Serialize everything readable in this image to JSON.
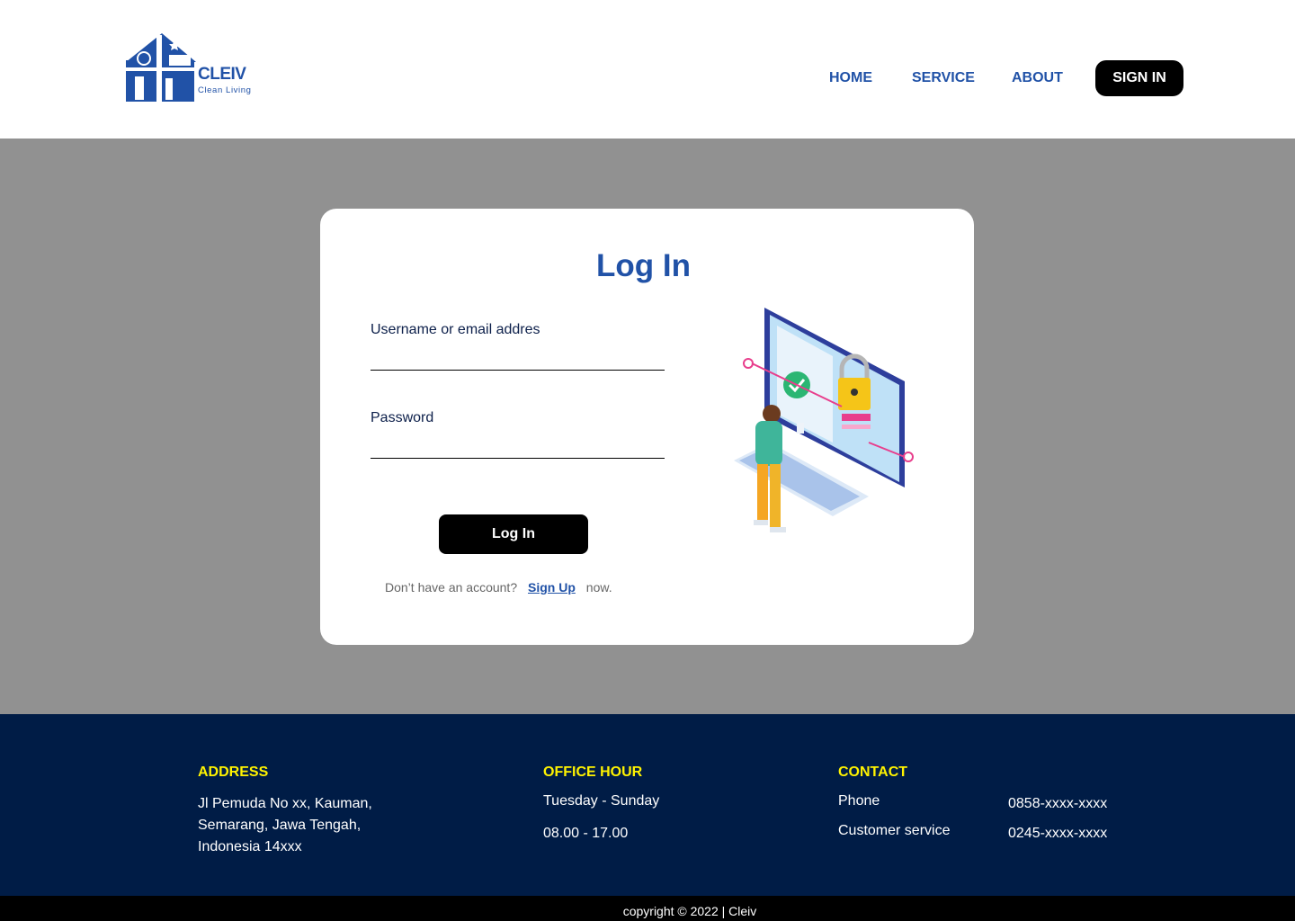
{
  "brand": {
    "name": "CLEIV",
    "tagline": "Clean Living",
    "colors": {
      "primary": "#2152a7",
      "footer_bg": "#001c46",
      "footer_heading": "#fff300"
    }
  },
  "nav": {
    "home": "HOME",
    "service": "SERVICE",
    "about": "ABOUT",
    "signin": "SIGN IN"
  },
  "login": {
    "title": "Log In",
    "username_label": "Username or email addres",
    "username_value": "",
    "password_label": "Password",
    "password_value": "",
    "submit_label": "Log In",
    "signup_prefix": "Don’t have an account?",
    "signup_link": "Sign Up",
    "signup_suffix": "now."
  },
  "footer": {
    "address": {
      "heading": "ADDRESS",
      "lines": [
        "Jl Pemuda  No xx, Kauman,",
        "Semarang, Jawa Tengah,",
        "Indonesia 14xxx"
      ]
    },
    "office": {
      "heading": "OFFICE HOUR",
      "days": "Tuesday - Sunday",
      "hours": "08.00 - 17.00"
    },
    "contact": {
      "heading": "CONTACT",
      "phone_label": "Phone",
      "phone_value": "0858-xxxx-xxxx",
      "cs_label": "Customer service",
      "cs_value": "0245-xxxx-xxxx"
    },
    "copyright": "copyright © 2022 | Cleiv"
  }
}
